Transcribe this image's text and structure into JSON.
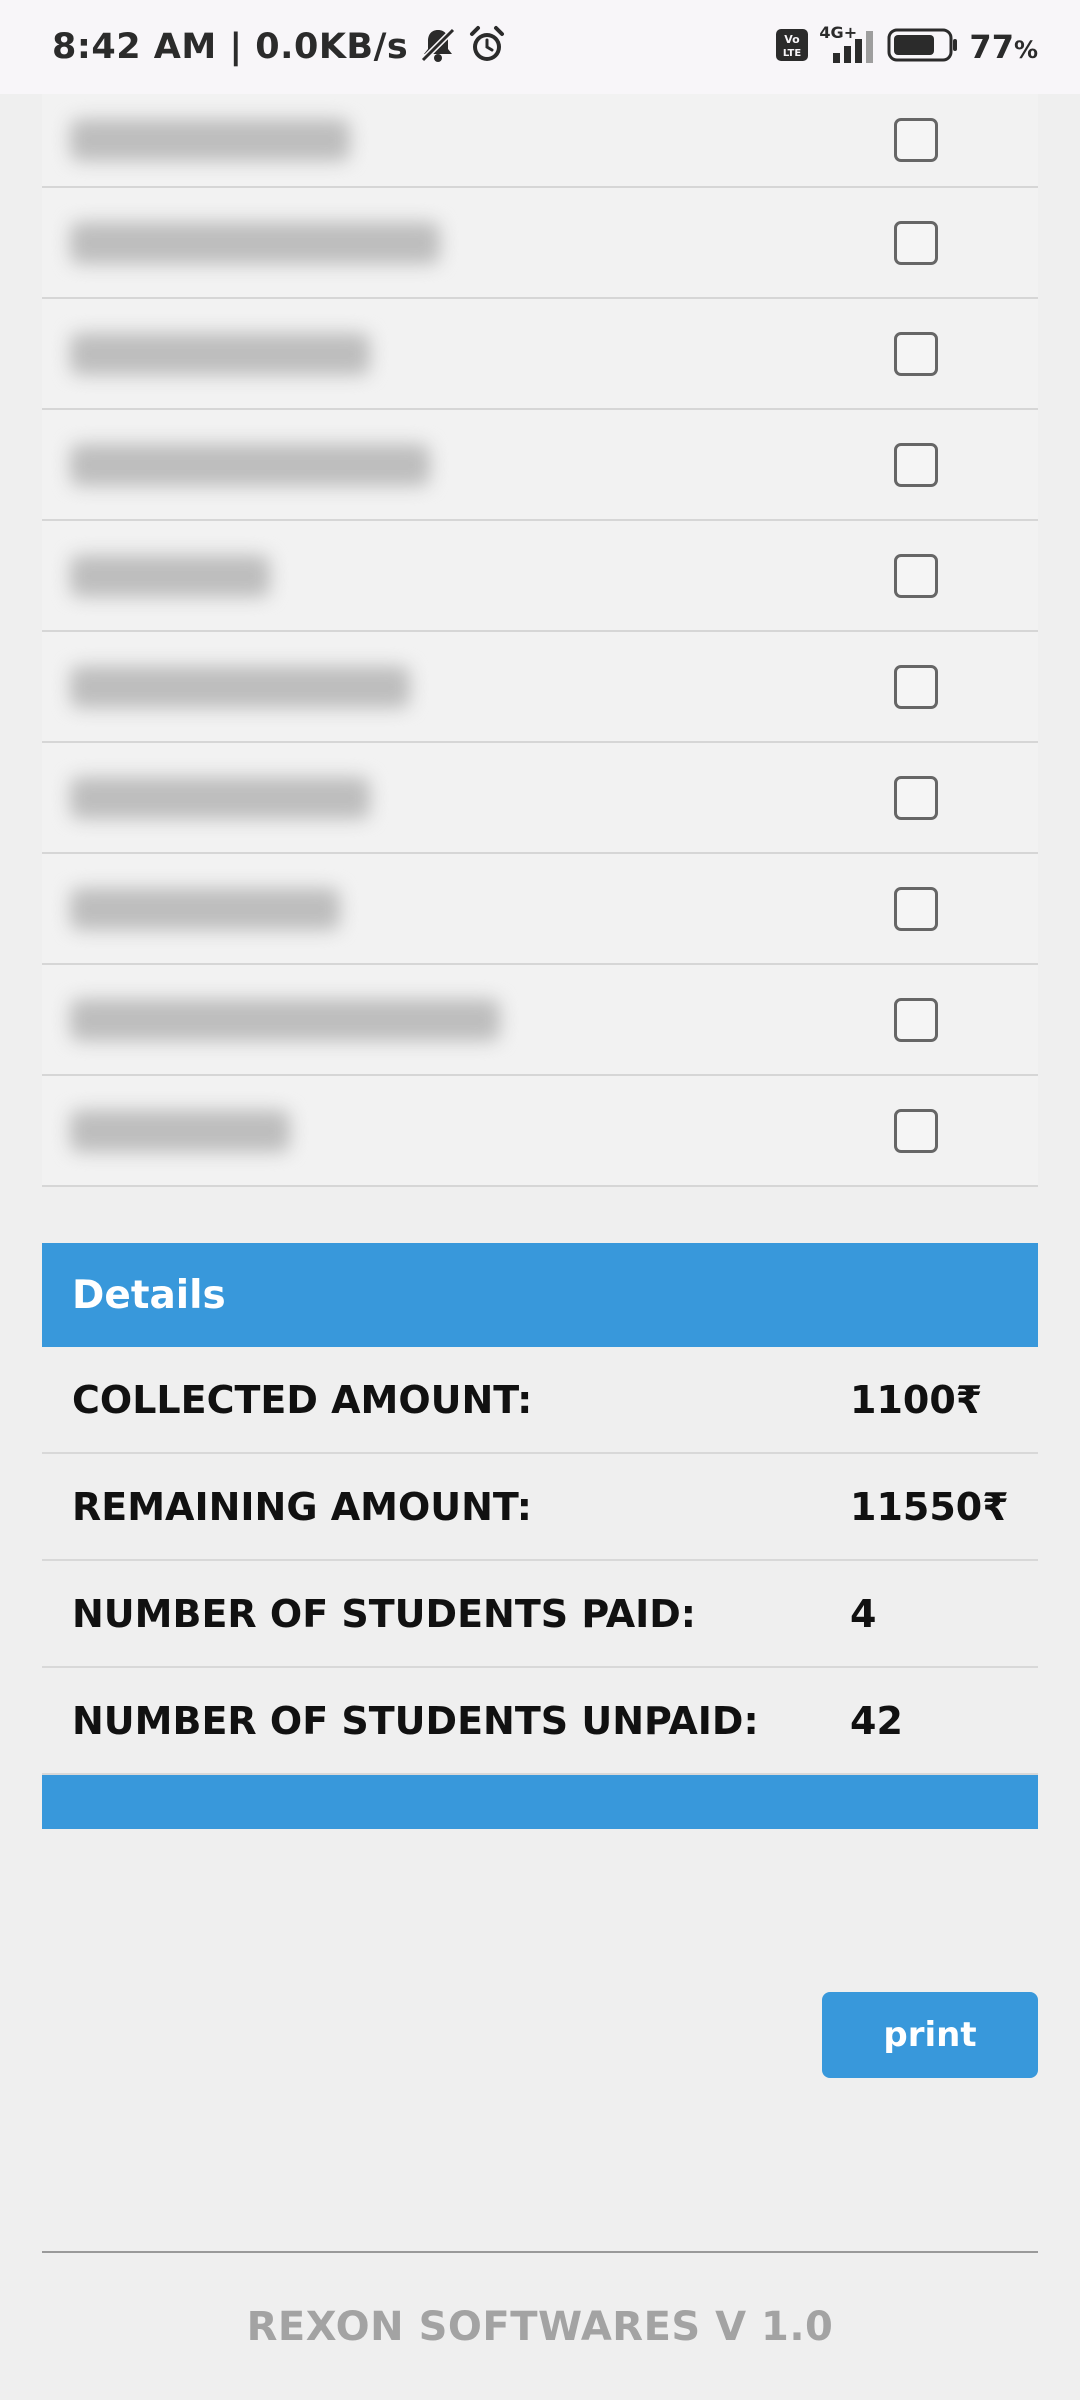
{
  "status_bar": {
    "time": "8:42 AM | 0.0KB/s",
    "network_label": "4G+",
    "volte_label": "Vo LTE",
    "battery_percent": "77",
    "battery_suffix": "%",
    "battery_level": 0.77,
    "icons": [
      "bell-off-icon",
      "alarm-icon",
      "volte-icon",
      "signal-icon",
      "battery-icon"
    ]
  },
  "student_list": {
    "rows": [
      {
        "name_width": 280,
        "checked": false
      },
      {
        "name_width": 370,
        "checked": false
      },
      {
        "name_width": 300,
        "checked": false
      },
      {
        "name_width": 360,
        "checked": false
      },
      {
        "name_width": 200,
        "checked": false
      },
      {
        "name_width": 340,
        "checked": false
      },
      {
        "name_width": 300,
        "checked": false
      },
      {
        "name_width": 270,
        "checked": false
      },
      {
        "name_width": 430,
        "checked": false
      },
      {
        "name_width": 220,
        "checked": false
      }
    ]
  },
  "details": {
    "title": "Details",
    "rows": [
      {
        "label": "COLLECTED AMOUNT:",
        "value": "1100₹"
      },
      {
        "label": "REMAINING AMOUNT:",
        "value": "11550₹"
      },
      {
        "label": "NUMBER OF STUDENTS PAID:",
        "value": "4"
      },
      {
        "label": "NUMBER OF STUDENTS UNPAID:",
        "value": "42"
      }
    ]
  },
  "actions": {
    "print_label": "print"
  },
  "footer": {
    "text": "REXON SOFTWARES V 1.0"
  },
  "colors": {
    "accent": "#3898db",
    "background": "#efefef"
  }
}
